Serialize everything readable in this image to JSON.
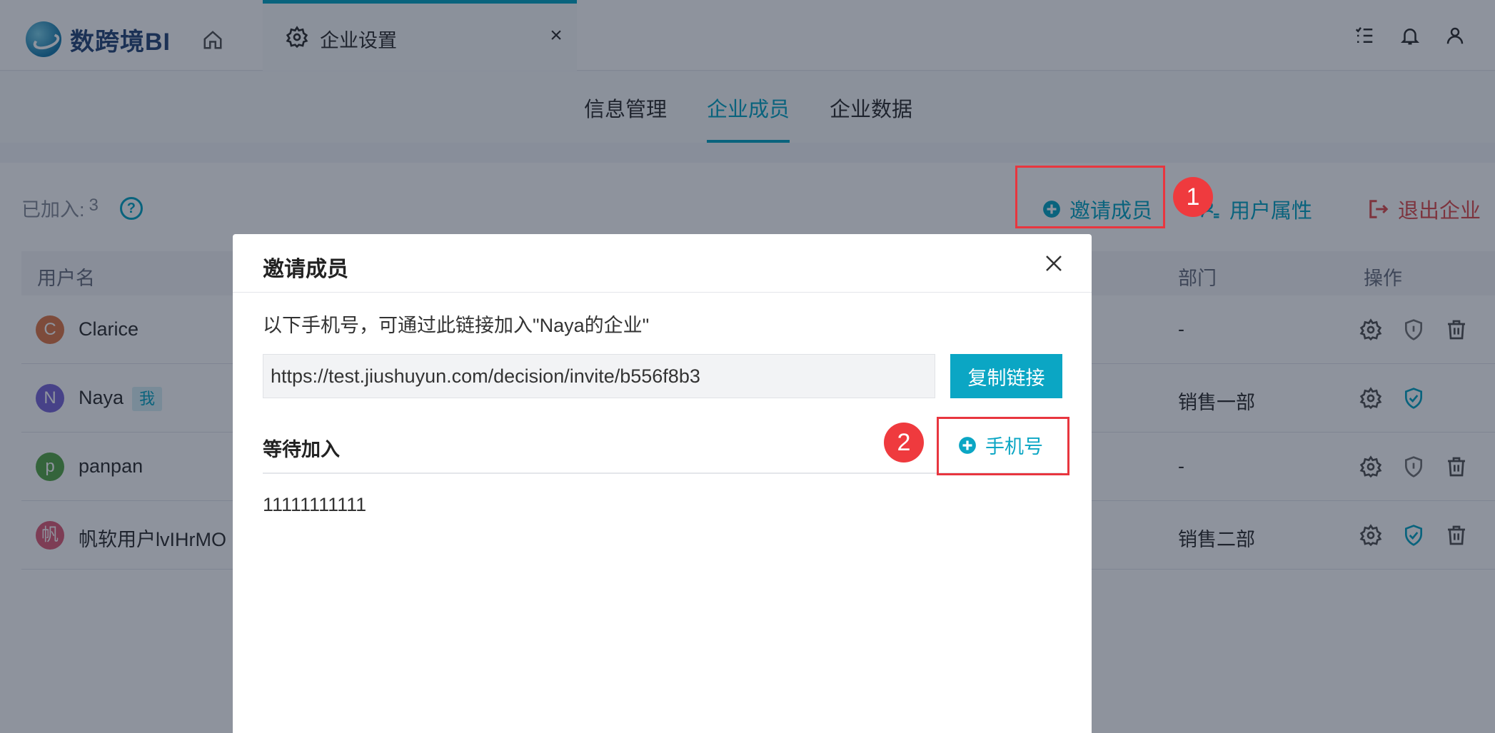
{
  "brand": {
    "name": "数跨境BI"
  },
  "tabs": [
    {
      "label": "企业设置"
    }
  ],
  "subnav": {
    "tabs": [
      "信息管理",
      "企业成员",
      "企业数据"
    ],
    "active": "企业成员"
  },
  "members": {
    "joined_label": "已加入:",
    "joined_count": "3",
    "actions": {
      "invite": "邀请成员",
      "attributes": "用户属性",
      "exit": "退出企业"
    },
    "columns": {
      "username": "用户名",
      "department": "部门",
      "operations": "操作"
    },
    "rows": [
      {
        "initial": "C",
        "name": "Clarice",
        "tag": "",
        "department": "-",
        "avatar_color": "#e07b4a"
      },
      {
        "initial": "N",
        "name": "Naya",
        "tag": "我",
        "department": "销售一部",
        "avatar_color": "#7d6ad8"
      },
      {
        "initial": "p",
        "name": "panpan",
        "tag": "",
        "department": "-",
        "avatar_color": "#5aa84a"
      },
      {
        "initial": "帆",
        "name": "帆软用户lvIHrMO",
        "tag": "",
        "department": "销售二部",
        "avatar_color": "#e0607a"
      }
    ]
  },
  "annotations": {
    "badge1": "1",
    "badge2": "2"
  },
  "modal": {
    "title": "邀请成员",
    "description": "以下手机号，可通过此链接加入\"Naya的企业\"",
    "invite_link": "https://test.jiushuyun.com/decision/invite/b556f8b3",
    "copy_button": "复制链接",
    "pending_title": "等待加入",
    "add_phone_button": "手机号",
    "pending_phones": [
      "11111111111"
    ]
  },
  "colors": {
    "accent": "#0ba6c4",
    "danger": "#e05050",
    "highlight": "#e8363f"
  }
}
